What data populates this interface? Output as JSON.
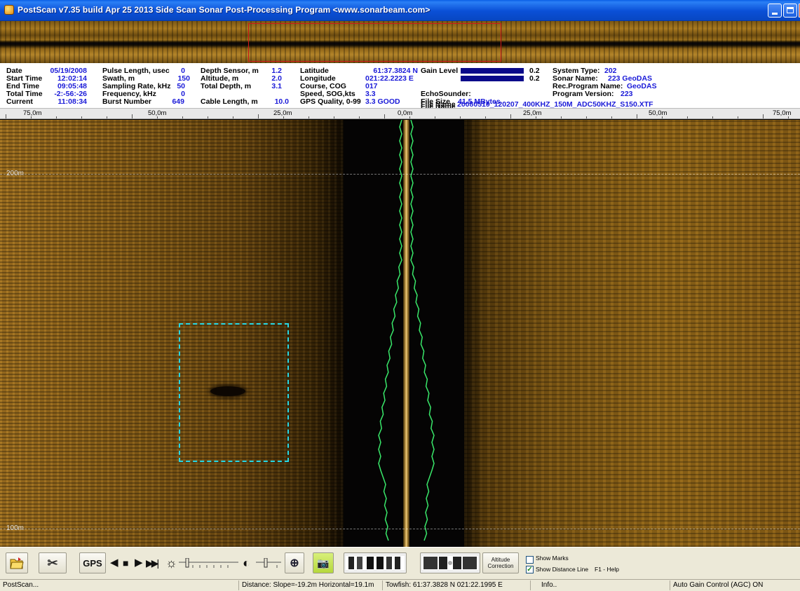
{
  "window": {
    "title": "PostScan v7.35 build Apr 25 2013  Side Scan Sonar Post-Processing Program  <www.sonarbeam.com>"
  },
  "info": {
    "col1": {
      "date_label": "Date",
      "date": "05/19/2008",
      "start_label": "Start Time",
      "start": "12:02:14",
      "end_label": "End  Time",
      "end": "09:05:48",
      "total_label": "Total Time",
      "total": "-2:-56:-26",
      "current_label": "Current",
      "current": "11:08:34"
    },
    "col2": {
      "pulse_label": "Pulse Length, usec",
      "pulse": "0",
      "swath_label": "Swath, m",
      "swath": "150",
      "sampling_label": "Sampling Rate, kHz",
      "sampling": "50",
      "freq_label": "Frequency, kHz",
      "freq": "0",
      "burst_label": "Burst Number",
      "burst": "649"
    },
    "col3": {
      "depth_sensor_label": "Depth Sensor, m",
      "depth_sensor": "1.2",
      "altitude_label": "Altitude, m",
      "altitude": "2.0",
      "total_depth_label": "Total Depth, m",
      "total_depth": "3.1",
      "cable_label": "Cable Length, m",
      "cable": "10.0"
    },
    "col4": {
      "lat_label": "Latitude",
      "lat": "61:37.3824 N",
      "lon_label": "Longitude",
      "lon": "021:22.2223 E",
      "course_label": "Course, COG",
      "course": "017",
      "speed_label": "Speed, SOG,kts",
      "speed": "3.3",
      "gps_label": "GPS Quality, 0-99",
      "gps": "3.3 GOOD"
    },
    "col5": {
      "gain_label": "Gain Level",
      "gain1": "0.2",
      "gain2": "0.2",
      "echo_label": "EchoSounder:",
      "filesize_label": "File Size",
      "filesize": "41.5 MBytes",
      "filename_label": "File Name",
      "filename": "20080519_120207_400KHZ_150M_ADC50KHZ_S150.XTF"
    },
    "col6": {
      "systype_label": "System Type:",
      "systype": "202",
      "sonarname_label": "Sonar Name:",
      "sonarname": "223 GeoDAS",
      "recprog_label": "Rec.Program Name:",
      "recprog": "GeoDAS",
      "progver_label": "Program Version:",
      "progver": "223"
    }
  },
  "ruler": [
    "75,0m",
    "50,0m",
    "25,0m",
    "0,0m",
    "25,0m",
    "50,0m",
    "75,0m"
  ],
  "sonar": {
    "range_labels": [
      "200m",
      "100m"
    ]
  },
  "toolbar": {
    "gps_label": "GPS",
    "altitude_label_1": "Altitude",
    "altitude_label_2": "Correction",
    "show_marks": "Show Marks",
    "show_distance": "Show Distance Line",
    "help": "F1 - Help"
  },
  "status": {
    "app": "PostScan...",
    "distance": "Distance: Slope=-19.2m Horizontal=19.1m",
    "towfish": "Towfish:  61:37.3828 N   021:22.1995 E",
    "info": "Info..",
    "agc": "Auto Gain Control (AGC) ON"
  },
  "colors": {
    "value_blue": "#1a1ad8",
    "bottom_trace": "#39e86a",
    "target_box": "#25d7e6",
    "overview_box": "#d01818"
  }
}
